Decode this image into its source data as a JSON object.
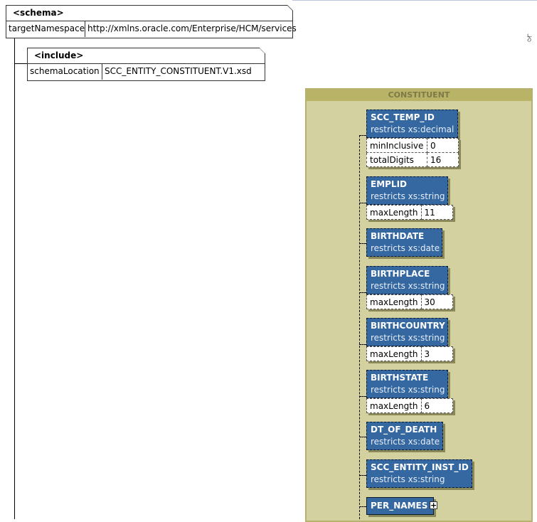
{
  "schema": {
    "title": "<schema>",
    "attr_name": "targetNamespace",
    "attr_value": "http://xmlns.oracle.com/Enterprise/HCM/services"
  },
  "include": {
    "title": "<include>",
    "attr_name": "schemaLocation",
    "attr_value": "SCC_ENTITY_CONSTITUENT.V1.xsd"
  },
  "side_mark": "ঠ",
  "complex_type": {
    "name": "CONSTITUENT",
    "elements": [
      {
        "name": "SCC_TEMP_ID",
        "restricts": "restricts xs:decimal",
        "facets": [
          {
            "name": "minInclusive",
            "value": "0"
          },
          {
            "name": "totalDigits",
            "value": "16"
          }
        ]
      },
      {
        "name": "EMPLID",
        "restricts": "restricts xs:string",
        "facets": [
          {
            "name": "maxLength",
            "value": "11"
          }
        ]
      },
      {
        "name": "BIRTHDATE",
        "restricts": "restricts xs:date",
        "facets": []
      },
      {
        "name": "BIRTHPLACE",
        "restricts": "restricts xs:string",
        "facets": [
          {
            "name": "maxLength",
            "value": "30"
          }
        ]
      },
      {
        "name": "BIRTHCOUNTRY",
        "restricts": "restricts xs:string",
        "facets": [
          {
            "name": "maxLength",
            "value": "3"
          }
        ]
      },
      {
        "name": "BIRTHSTATE",
        "restricts": "restricts xs:string",
        "facets": [
          {
            "name": "maxLength",
            "value": "6"
          }
        ]
      },
      {
        "name": "DT_OF_DEATH",
        "restricts": "restricts xs:date",
        "facets": []
      },
      {
        "name": "SCC_ENTITY_INST_ID",
        "restricts": "restricts xs:string",
        "facets": []
      }
    ],
    "collapsed_element": "PER_NAMES",
    "expand_symbol": "+"
  }
}
